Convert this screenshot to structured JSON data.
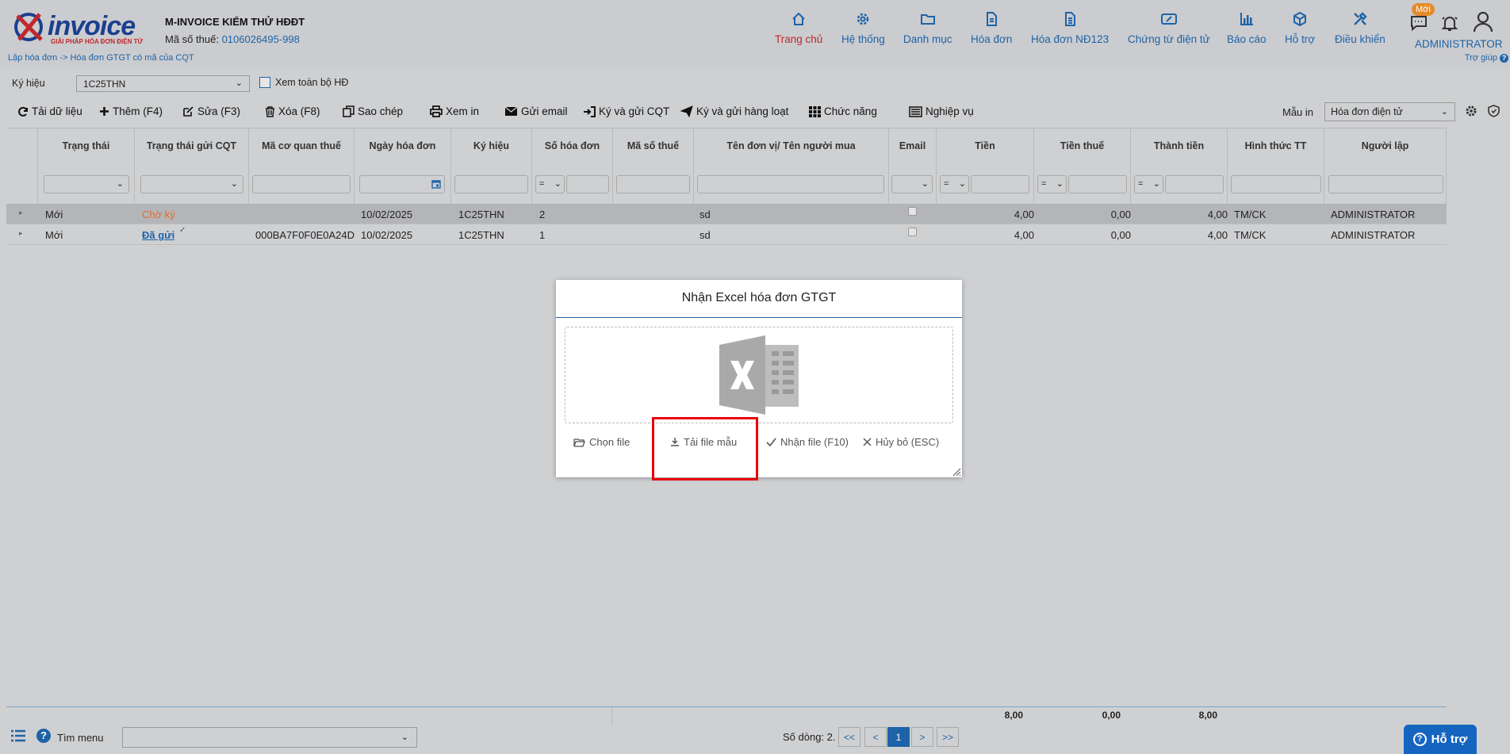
{
  "header": {
    "logo_text": "invoice",
    "logo_tagline": "GIẢI PHÁP HÓA ĐƠN ĐIỆN TỬ",
    "company_name": "M-INVOICE KIỂM THỬ HĐĐT",
    "tax_label": "Mã số thuế:",
    "tax_value": "0106026495-998",
    "breadcrumb": "Lập hóa đơn -> Hóa đơn GTGT có mã của CQT",
    "help_link": "Trợ giúp",
    "badge_new": "Mới",
    "user": "ADMINISTRATOR",
    "nav": [
      {
        "label": "Trang chủ",
        "icon": "home-icon"
      },
      {
        "label": "Hệ thống",
        "icon": "gear-icon"
      },
      {
        "label": "Danh mục",
        "icon": "folder-icon"
      },
      {
        "label": "Hóa đơn",
        "icon": "document-icon"
      },
      {
        "label": "Hóa đơn NĐ123",
        "icon": "document-lines-icon"
      },
      {
        "label": "Chứng từ điện tử",
        "icon": "ticket-icon"
      },
      {
        "label": "Báo cáo",
        "icon": "bar-chart-icon"
      },
      {
        "label": "Hỗ trợ",
        "icon": "cube-icon"
      },
      {
        "label": "Điều khiển",
        "icon": "tools-icon"
      }
    ]
  },
  "filter_bar": {
    "kyhieu_label": "Ký hiệu",
    "kyhieu_value": "1C25THN",
    "xem_toan_bo": "Xem toàn bộ HĐ"
  },
  "toolbar": {
    "reload": "Tải dữ liệu",
    "add": "Thêm (F4)",
    "edit": "Sửa (F3)",
    "delete": "Xóa (F8)",
    "copy": "Sao chép",
    "print": "Xem in",
    "email": "Gửi email",
    "sign_send": "Ký và gửi CQT",
    "sign_batch": "Ký và gửi hàng loạt",
    "functions": "Chức năng",
    "business": "Nghiệp vụ",
    "mau_in_label": "Mẫu in",
    "mau_in_value": "Hóa đơn điện tử"
  },
  "grid": {
    "columns": [
      "Trạng thái",
      "Trạng thái gửi CQT",
      "Mã cơ quan thuế",
      "Ngày hóa đơn",
      "Ký hiệu",
      "Số hóa đơn",
      "Mã số thuế",
      "Tên đơn vị/ Tên người mua",
      "Email",
      "Tiền",
      "Tiền thuế",
      "Thành tiền",
      "Hình thức TT",
      "Người lập"
    ],
    "filter_ops": [
      "=",
      "=",
      "=",
      "="
    ],
    "rows": [
      {
        "status": "Mới",
        "cqt_status": "Chờ ký",
        "ma_cqt": "",
        "date": "10/02/2025",
        "kyhieu": "1C25THN",
        "so_hd": "2",
        "mst": "",
        "buyer": "sd",
        "tien": "4,00",
        "thue": "0,00",
        "thanh_tien": "4,00",
        "httt": "TM/CK",
        "nguoi_lap": "ADMINISTRATOR"
      },
      {
        "status": "Mới",
        "cqt_status": "Đã gửi",
        "ma_cqt": "000BA7F0F0E0A24D",
        "date": "10/02/2025",
        "kyhieu": "1C25THN",
        "so_hd": "1",
        "mst": "",
        "buyer": "sd",
        "tien": "4,00",
        "thue": "0,00",
        "thanh_tien": "4,00",
        "httt": "TM/CK",
        "nguoi_lap": "ADMINISTRATOR"
      }
    ],
    "totals": {
      "tien": "8,00",
      "thue": "0,00",
      "thanh_tien": "8,00"
    }
  },
  "bottom": {
    "tim_menu": "Tìm menu",
    "so_dong": "Số dòng: 2.",
    "pages": [
      "<<",
      "<",
      "1",
      ">",
      ">>"
    ],
    "ho_tro": "Hỗ trợ"
  },
  "dialog": {
    "title": "Nhận Excel hóa đơn GTGT",
    "choose_file": "Chọn file",
    "download_template": "Tải file mẫu",
    "receive_file": "Nhận file (F10)",
    "cancel": "Hủy bỏ (ESC)"
  },
  "colors": {
    "accent": "#1e63a7",
    "active_nav": "#c0272d",
    "pending": "#e46b2e",
    "highlight": "#e8000b"
  }
}
